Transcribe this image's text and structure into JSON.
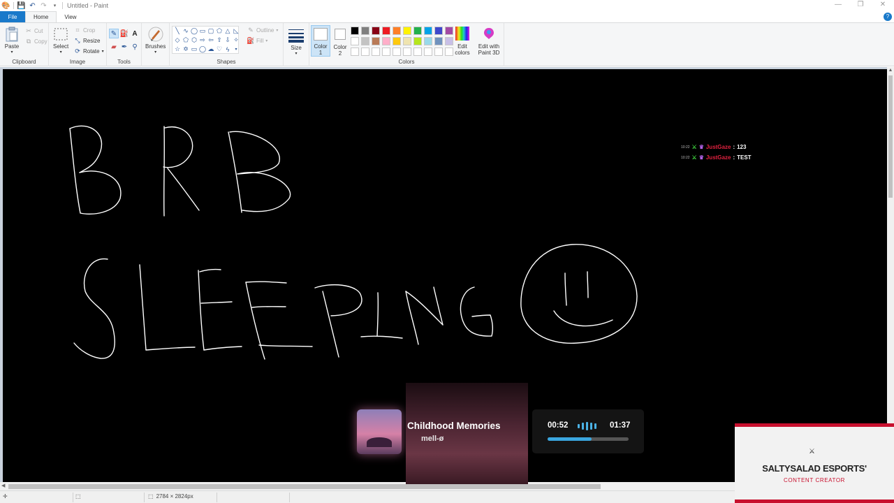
{
  "window": {
    "title": "Untitled - Paint",
    "controls": [
      "—",
      "❐",
      "✕"
    ]
  },
  "tabs": {
    "file": "File",
    "home": "Home",
    "view": "View",
    "help": "?"
  },
  "ribbon": {
    "clipboard": {
      "label": "Clipboard",
      "paste": "Paste",
      "cut": "Cut",
      "copy": "Copy"
    },
    "image": {
      "label": "Image",
      "select": "Select",
      "crop": "Crop",
      "resize": "Resize",
      "rotate": "Rotate"
    },
    "tools": {
      "label": "Tools"
    },
    "brushes": "Brushes",
    "shapes": {
      "label": "Shapes",
      "outline": "Outline",
      "fill": "Fill"
    },
    "size": "Size",
    "colors": {
      "label": "Colors",
      "color1_a": "Color",
      "color1_b": "1",
      "color2_a": "Color",
      "color2_b": "2",
      "edit_a": "Edit",
      "edit_b": "colors",
      "p3d_a": "Edit with",
      "p3d_b": "Paint 3D"
    },
    "palette_row1": [
      "#000000",
      "#7f7f7f",
      "#880015",
      "#ed1c24",
      "#ff7f27",
      "#fff200",
      "#22b14c",
      "#00a2e8",
      "#3f48cc",
      "#a349a4"
    ],
    "palette_row2": [
      "#ffffff",
      "#c3c3c3",
      "#b97a57",
      "#ffaec9",
      "#ffc90e",
      "#efe4b0",
      "#b5e61d",
      "#99d9ea",
      "#7092be",
      "#c8bfe7"
    ],
    "palette_row3": [
      "#ffffff",
      "#ffffff",
      "#ffffff",
      "#ffffff",
      "#ffffff",
      "#ffffff",
      "#ffffff",
      "#ffffff",
      "#ffffff",
      "#ffffff"
    ]
  },
  "chat": [
    {
      "time": "10:22",
      "user": "JustGaze",
      "sep": ":",
      "message": "123"
    },
    {
      "time": "10:22",
      "user": "JustGaze",
      "sep": ":",
      "message": "TEST"
    }
  ],
  "now_playing": {
    "title": "Childhood Memories",
    "artist": "mell-ø",
    "elapsed": "00:52",
    "total": "01:37",
    "progress": 0.54
  },
  "badge": {
    "name": "SALTYSALAD ESPORTS'",
    "role": "CONTENT CREATOR"
  },
  "statusbar": {
    "dimensions": "2784 × 2824px"
  }
}
